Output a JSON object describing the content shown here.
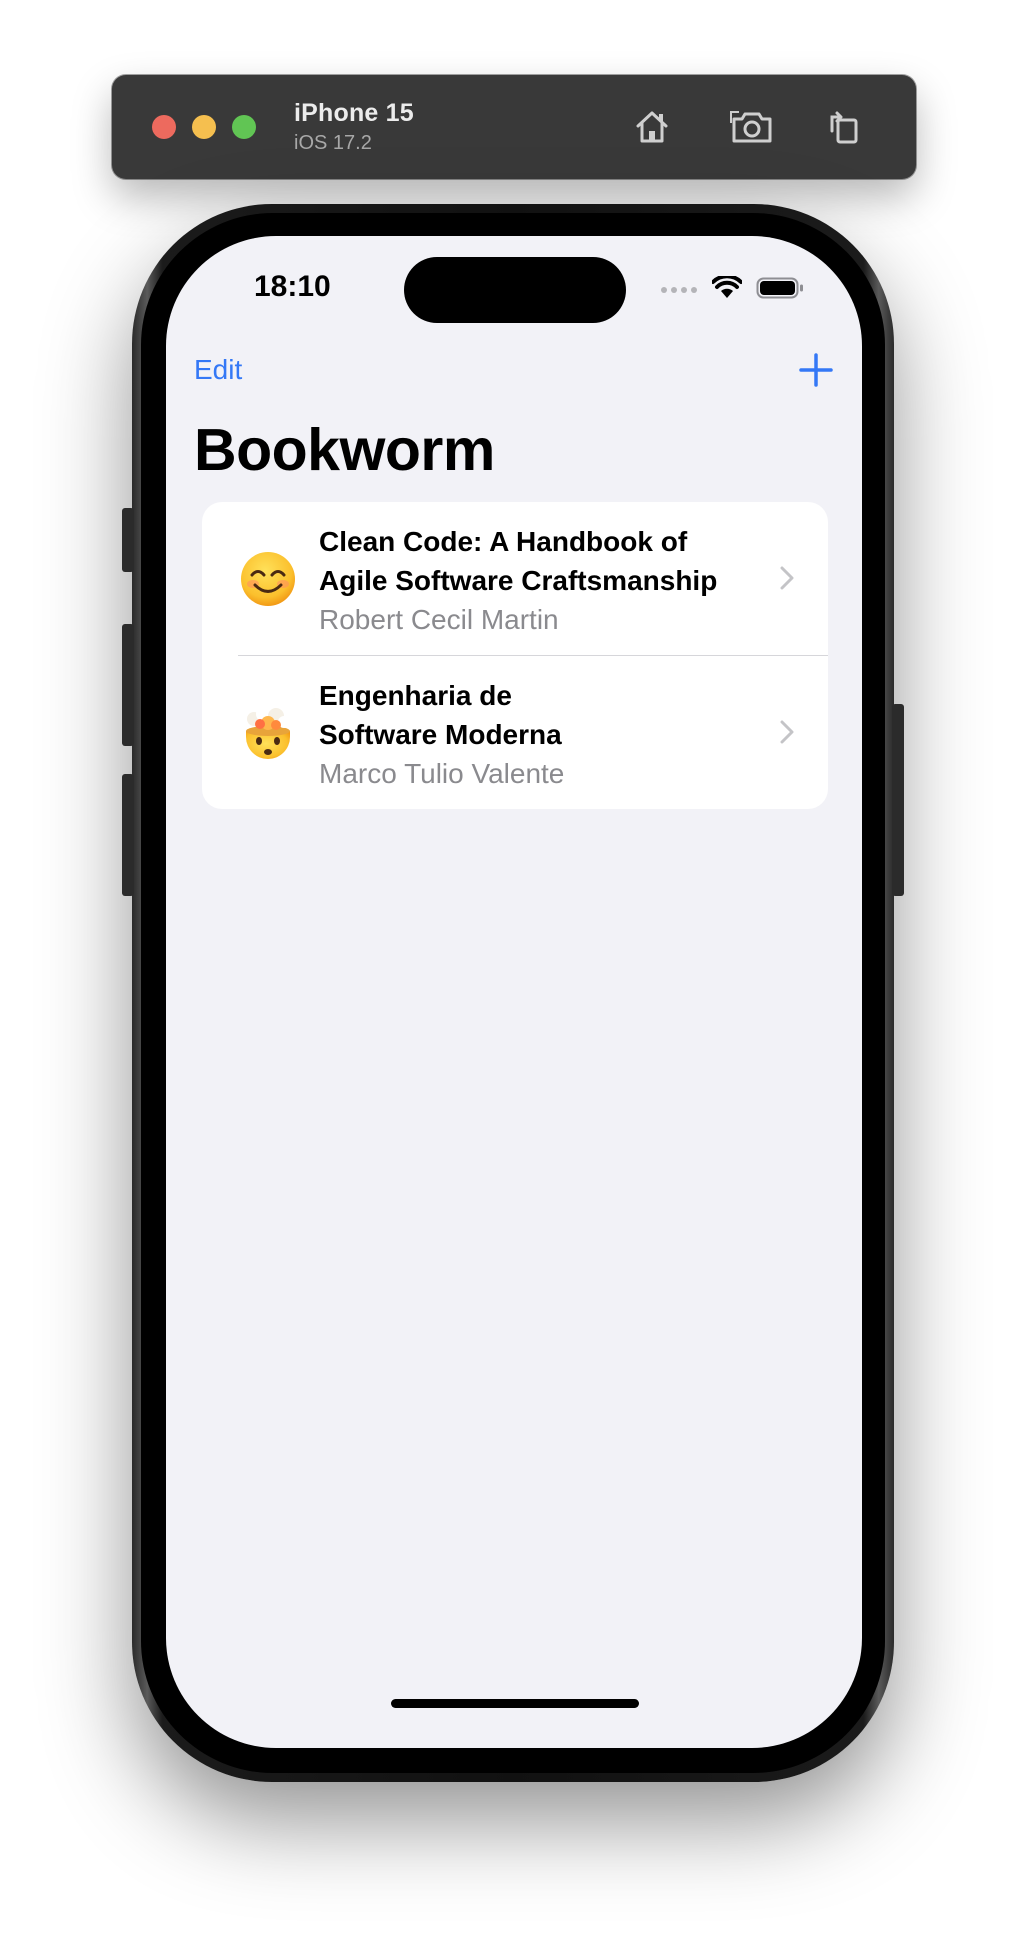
{
  "simulator": {
    "device_name": "iPhone 15",
    "os_version": "iOS 17.2",
    "toolbar_icons": [
      "home-icon",
      "screenshot-icon",
      "rotate-icon"
    ]
  },
  "status_bar": {
    "time": "18:10",
    "icons": [
      "signal-icon",
      "wifi-icon",
      "battery-icon"
    ]
  },
  "nav": {
    "edit_label": "Edit",
    "add_icon": "plus-icon",
    "title": "Bookworm"
  },
  "books": [
    {
      "emoji": "smiling-face-emoji",
      "title_line1": "Clean Code: A Handbook of",
      "title_line2": "Agile Software Craftsmanship",
      "author": "Robert Cecil Martin"
    },
    {
      "emoji": "exploding-head-emoji",
      "title_line1": "Engenharia de",
      "title_line2": "Software Moderna",
      "author": "Marco Tulio Valente"
    }
  ],
  "colors": {
    "accent": "#3478f6",
    "background": "#f2f2f7",
    "secondary_text": "#8a8a8e"
  }
}
